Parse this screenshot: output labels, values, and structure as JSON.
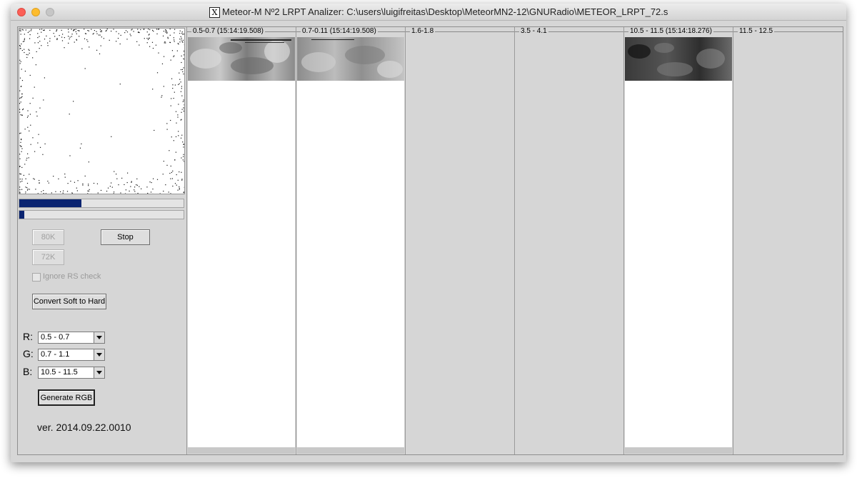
{
  "window": {
    "title": "Meteor-M Nº2 LRPT Analizer: C:\\users\\luigifreitas\\Desktop\\MeteorMN2-12\\GNURadio\\METEOR_LRPT_72.s"
  },
  "progress": {
    "bar1_fraction": 0.38,
    "bar2_fraction": 0.03
  },
  "controls": {
    "btn_80k": "80K",
    "btn_72k": "72K",
    "btn_stop": "Stop",
    "ignore_rs_label": "Ignore RS check",
    "ignore_rs_checked": false,
    "convert_label": "Convert Soft to Hard",
    "generate_rgb_label": "Generate RGB"
  },
  "rgb": {
    "r_label": "R:",
    "r_value": "0.5 - 0.7",
    "g_label": "G:",
    "g_value": "0.7 - 1.1",
    "b_label": "B:",
    "b_value": "10.5 - 11.5"
  },
  "version": "ver. 2014.09.22.0010",
  "channels": [
    {
      "title": "0.5-0.7 (15:14:19.508)",
      "has_image": true
    },
    {
      "title": "0.7-0.11 (15:14:19.508)",
      "has_image": true
    },
    {
      "title": "1.6-1.8",
      "has_image": false
    },
    {
      "title": "3.5 - 4.1",
      "has_image": false
    },
    {
      "title": "10.5 - 11.5 (15:14:18.276)",
      "has_image": true
    },
    {
      "title": "11.5 - 12.5",
      "has_image": false
    }
  ]
}
